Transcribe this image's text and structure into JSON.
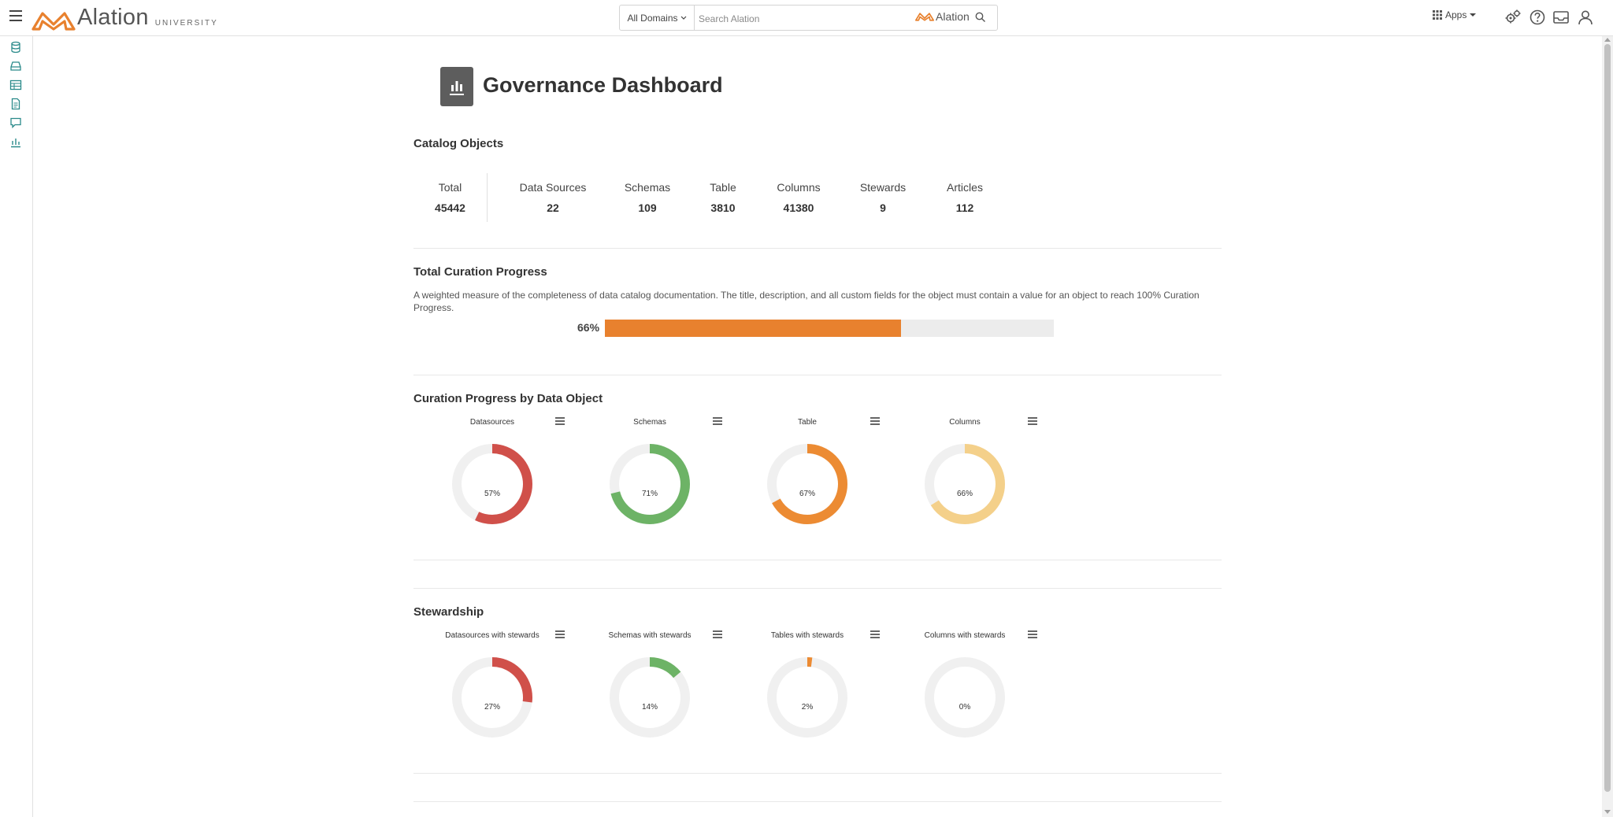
{
  "header": {
    "logo_text": "Alation",
    "logo_sub": "UNIVERSITY",
    "domain_select": "All Domains",
    "search_placeholder": "Search Alation",
    "search_brand": "Alation",
    "apps_label": "Apps"
  },
  "page": {
    "title": "Governance Dashboard"
  },
  "catalog": {
    "title": "Catalog Objects",
    "stats": [
      {
        "label": "Total",
        "value": "45442"
      },
      {
        "label": "Data Sources",
        "value": "22"
      },
      {
        "label": "Schemas",
        "value": "109"
      },
      {
        "label": "Table",
        "value": "3810"
      },
      {
        "label": "Columns",
        "value": "41380"
      },
      {
        "label": "Stewards",
        "value": "9"
      },
      {
        "label": "Articles",
        "value": "112"
      }
    ]
  },
  "curation": {
    "title": "Total Curation Progress",
    "description": "A weighted measure of the completeness of data catalog documentation. The title, description, and all custom fields for the object must contain a value for an object to reach 100% Curation Progress.",
    "percent_label": "66%",
    "percent": 66
  },
  "by_object": {
    "title": "Curation Progress by Data Object",
    "charts": [
      {
        "title": "Datasources",
        "label": "57%",
        "value": 57,
        "color": "#d0504a"
      },
      {
        "title": "Schemas",
        "label": "71%",
        "value": 71,
        "color": "#6db366"
      },
      {
        "title": "Table",
        "label": "67%",
        "value": 67,
        "color": "#ec8b33"
      },
      {
        "title": "Columns",
        "label": "66%",
        "value": 66,
        "color": "#f4d08a"
      }
    ]
  },
  "stewardship": {
    "title": "Stewardship",
    "charts": [
      {
        "title": "Datasources with stewards",
        "label": "27%",
        "value": 27,
        "color": "#d0504a"
      },
      {
        "title": "Schemas with stewards",
        "label": "14%",
        "value": 14,
        "color": "#6db366"
      },
      {
        "title": "Tables with stewards",
        "label": "2%",
        "value": 2,
        "color": "#ec8b33"
      },
      {
        "title": "Columns with stewards",
        "label": "0%",
        "value": 0,
        "color": "#f4d08a"
      }
    ]
  },
  "colors": {
    "brand": "#e8812e",
    "teal": "#2a8a8a",
    "track": "#f0f0f0"
  }
}
